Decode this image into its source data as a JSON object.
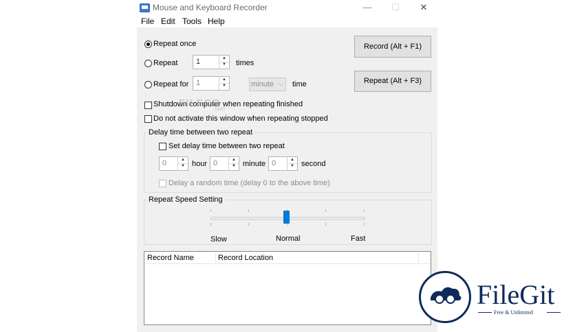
{
  "window": {
    "title": "Mouse and Keyboard Recorder",
    "controls": [
      "—",
      "☐",
      "✕"
    ]
  },
  "menu": [
    "File",
    "Edit",
    "Tools",
    "Help"
  ],
  "repeat": {
    "once_label": "Repeat once",
    "repeat_label": "Repeat",
    "repeat_value": "1",
    "times_label": "times",
    "repeat_for_label": "Repeat for",
    "repeat_for_value": "1",
    "unit_selected": "minute",
    "time_label": "time"
  },
  "buttons": {
    "record": "Record (Alt + F1)",
    "repeat": "Repeat (Alt + F3)"
  },
  "options": {
    "shutdown": "Shutdown computer when repeating finished",
    "no_activate": "Do not activate this window when repeating stopped"
  },
  "delay": {
    "group_title": "Delay time between two repeat",
    "set_label": "Set delay time between two repeat",
    "hour_value": "0",
    "hour_label": "hour",
    "minute_value": "0",
    "minute_label": "minute",
    "second_value": "0",
    "second_label": "second",
    "random_label": "Delay a random time (delay 0 to the above time)"
  },
  "speed": {
    "group_title": "Repeat Speed Setting",
    "slow": "Slow",
    "normal": "Normal",
    "fast": "Fast",
    "level": 0.5
  },
  "list": {
    "columns": [
      "Record Name",
      "Record Location"
    ],
    "rows": []
  },
  "watermarks": {
    "filecr": "FILECR",
    "filecr_sub": ".com",
    "filegit": "FileGit",
    "filegit_sub": "Free & Unlimited"
  },
  "colors": {
    "accent": "#0078d7",
    "logo": "#0f2a5a"
  }
}
